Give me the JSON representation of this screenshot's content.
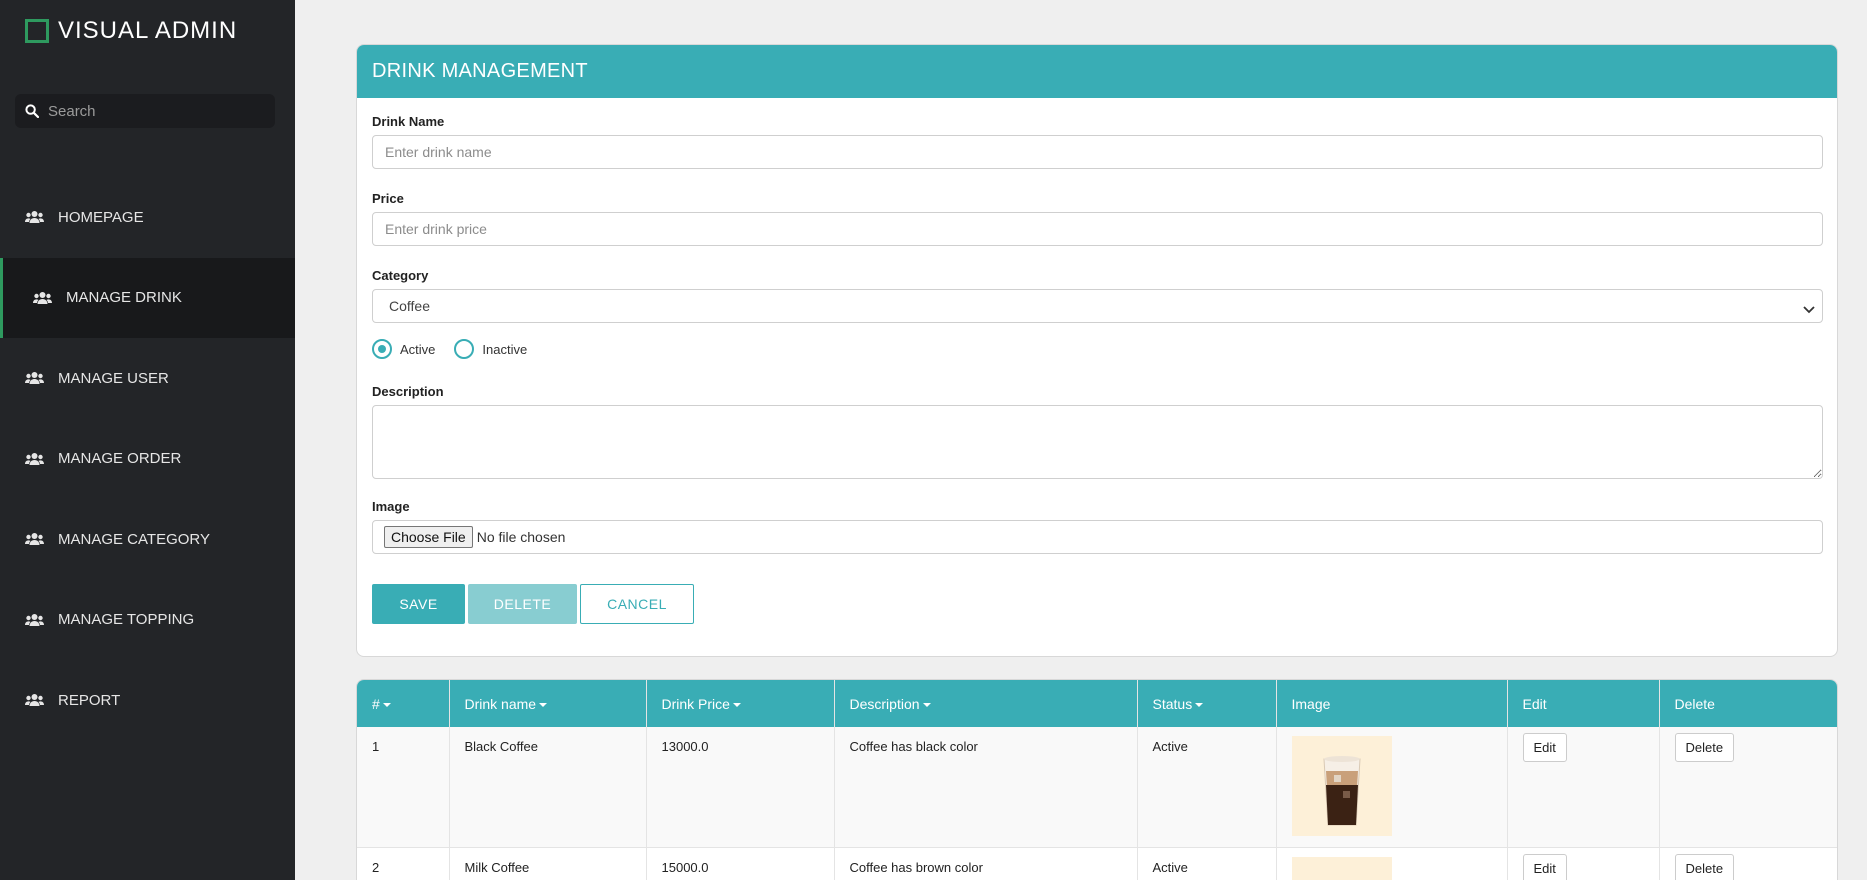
{
  "brand": {
    "title": "VISUAL ADMIN",
    "accent_color": "#2e9a5f"
  },
  "search": {
    "placeholder": "Search",
    "icon": "search-icon"
  },
  "nav": {
    "items": [
      {
        "label": "HOMEPAGE",
        "icon": "users-icon",
        "active": false
      },
      {
        "label": "MANAGE DRINK",
        "icon": "users-icon",
        "active": true
      },
      {
        "label": "MANAGE USER",
        "icon": "users-icon",
        "active": false
      },
      {
        "label": "MANAGE ORDER",
        "icon": "users-icon",
        "active": false
      },
      {
        "label": "MANAGE CATEGORY",
        "icon": "users-icon",
        "active": false
      },
      {
        "label": "MANAGE TOPPING",
        "icon": "users-icon",
        "active": false
      },
      {
        "label": "REPORT",
        "icon": "users-icon",
        "active": false
      }
    ]
  },
  "form": {
    "title": "DRINK MANAGEMENT",
    "header_color": "#39adb5",
    "drink_name": {
      "label": "Drink Name",
      "placeholder": "Enter drink name",
      "value": ""
    },
    "price": {
      "label": "Price",
      "placeholder": "Enter drink price",
      "value": ""
    },
    "category": {
      "label": "Category",
      "selected": "Coffee"
    },
    "status": {
      "active_label": "Active",
      "inactive_label": "Inactive",
      "selected": "Active"
    },
    "description": {
      "label": "Description",
      "value": ""
    },
    "image": {
      "label": "Image",
      "button_label": "Choose File",
      "file_text": "No file chosen"
    },
    "buttons": {
      "save": "SAVE",
      "delete": "DELETE",
      "cancel": "CANCEL"
    }
  },
  "table": {
    "headers": [
      "#",
      "Drink name",
      "Drink Price",
      "Description",
      "Status",
      "Image",
      "Edit",
      "Delete"
    ],
    "rows": [
      {
        "id": "1",
        "name": "Black Coffee",
        "price": "13000.0",
        "description": "Coffee has black color",
        "status": "Active",
        "edit": "Edit",
        "delete": "Delete"
      },
      {
        "id": "2",
        "name": "Milk Coffee",
        "price": "15000.0",
        "description": "Coffee has brown color",
        "status": "Active",
        "edit": "Edit",
        "delete": "Delete"
      }
    ]
  }
}
